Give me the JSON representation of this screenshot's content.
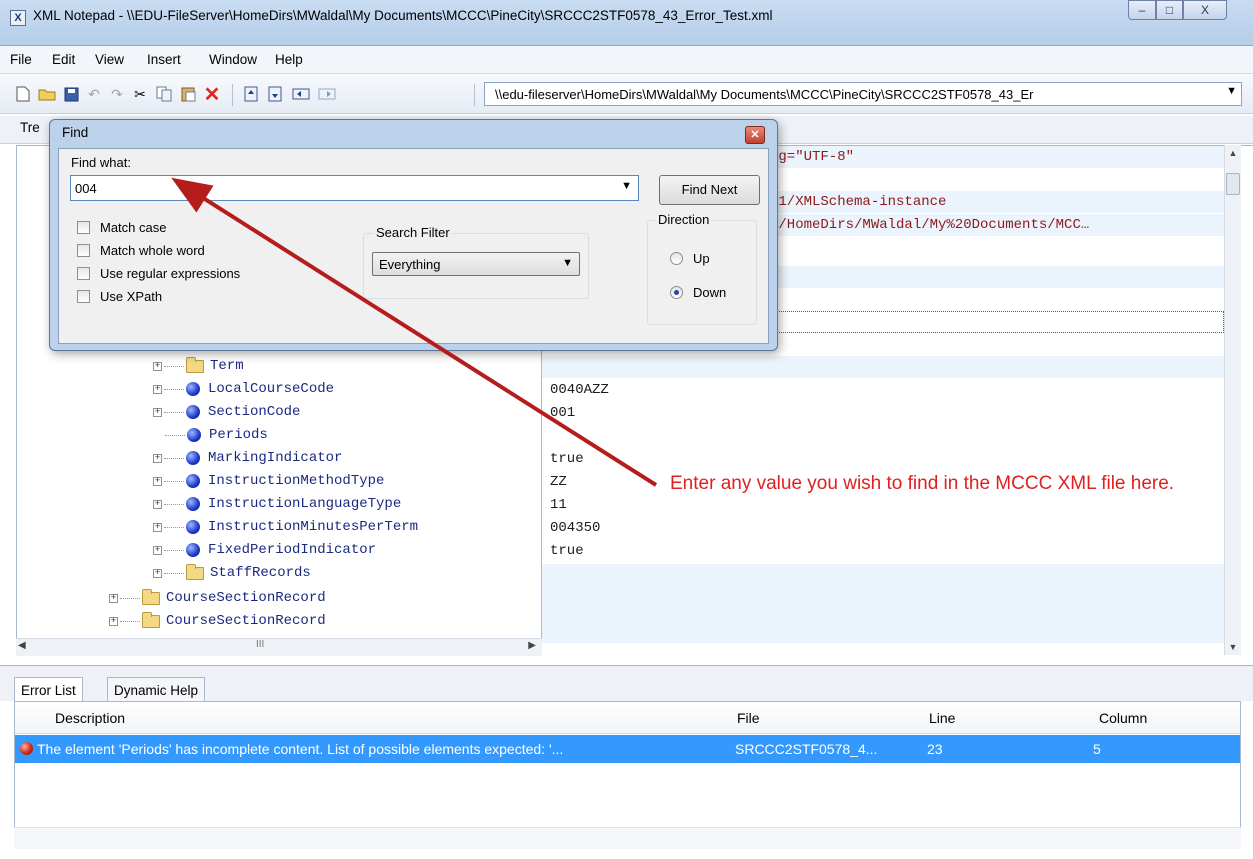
{
  "window": {
    "title": "XML Notepad - \\\\EDU-FileServer\\HomeDirs\\MWaldal\\My Documents\\MCCC\\PineCity\\SRCCC2STF0578_43_Error_Test.xml",
    "minimize": "–",
    "maximize": "□",
    "close": "X"
  },
  "menu": [
    "File",
    "Edit",
    "View",
    "Insert",
    "Window",
    "Help"
  ],
  "toolbar": {
    "path": "\\\\edu-fileserver\\HomeDirs\\MWaldal\\My Documents\\MCCC\\PineCity\\SRCCC2STF0578_43_Er"
  },
  "tabs": {
    "tree_tab_label": "Tre"
  },
  "find_dialog": {
    "title": "Find",
    "find_what_label": "Find what:",
    "find_what_value": "004",
    "find_next_label": "Find Next",
    "options": [
      "Match case",
      "Match whole word",
      "Use regular expressions",
      "Use XPath"
    ],
    "search_filter_label": "Search Filter",
    "search_filter_value": "Everything",
    "direction_label": "Direction",
    "up_label": "Up",
    "down_label": "Down",
    "direction_selected": "Down"
  },
  "tree": [
    {
      "label": "Term",
      "type": "folder"
    },
    {
      "label": "LocalCourseCode",
      "type": "element"
    },
    {
      "label": "SectionCode",
      "type": "element"
    },
    {
      "label": "Periods",
      "type": "element"
    },
    {
      "label": "MarkingIndicator",
      "type": "element"
    },
    {
      "label": "InstructionMethodType",
      "type": "element"
    },
    {
      "label": "InstructionLanguageType",
      "type": "element"
    },
    {
      "label": "InstructionMinutesPerTerm",
      "type": "element"
    },
    {
      "label": "FixedPeriodIndicator",
      "type": "element"
    },
    {
      "label": "StaffRecords",
      "type": "folder"
    },
    {
      "label": "CourseSectionRecord",
      "type": "folder"
    },
    {
      "label": "CourseSectionRecord",
      "type": "folder"
    }
  ],
  "values_top": [
    "ng=\"UTF-8\"",
    "01/XMLSchema-instance",
    "r/HomeDirs/MWaldal/My%20Documents/MCC…"
  ],
  "values": [
    "",
    "0040AZZ",
    "001",
    "",
    "true",
    "ZZ",
    "11",
    "004350",
    "true"
  ],
  "annotation": {
    "text": "Enter any value you wish to find in the MCCC XML file here.",
    "color": "#e02020"
  },
  "bottom_tabs": [
    "Error List",
    "Dynamic Help"
  ],
  "error_list": {
    "columns": [
      "Description",
      "File",
      "Line",
      "Column"
    ],
    "rows": [
      {
        "description": "The element 'Periods' has incomplete content. List of possible elements expected: '...",
        "file": "SRCCC2STF0578_4...",
        "line": "23",
        "column": "5"
      }
    ],
    "selected_row_color": "#3399ff"
  },
  "hscroll_grip": "III"
}
